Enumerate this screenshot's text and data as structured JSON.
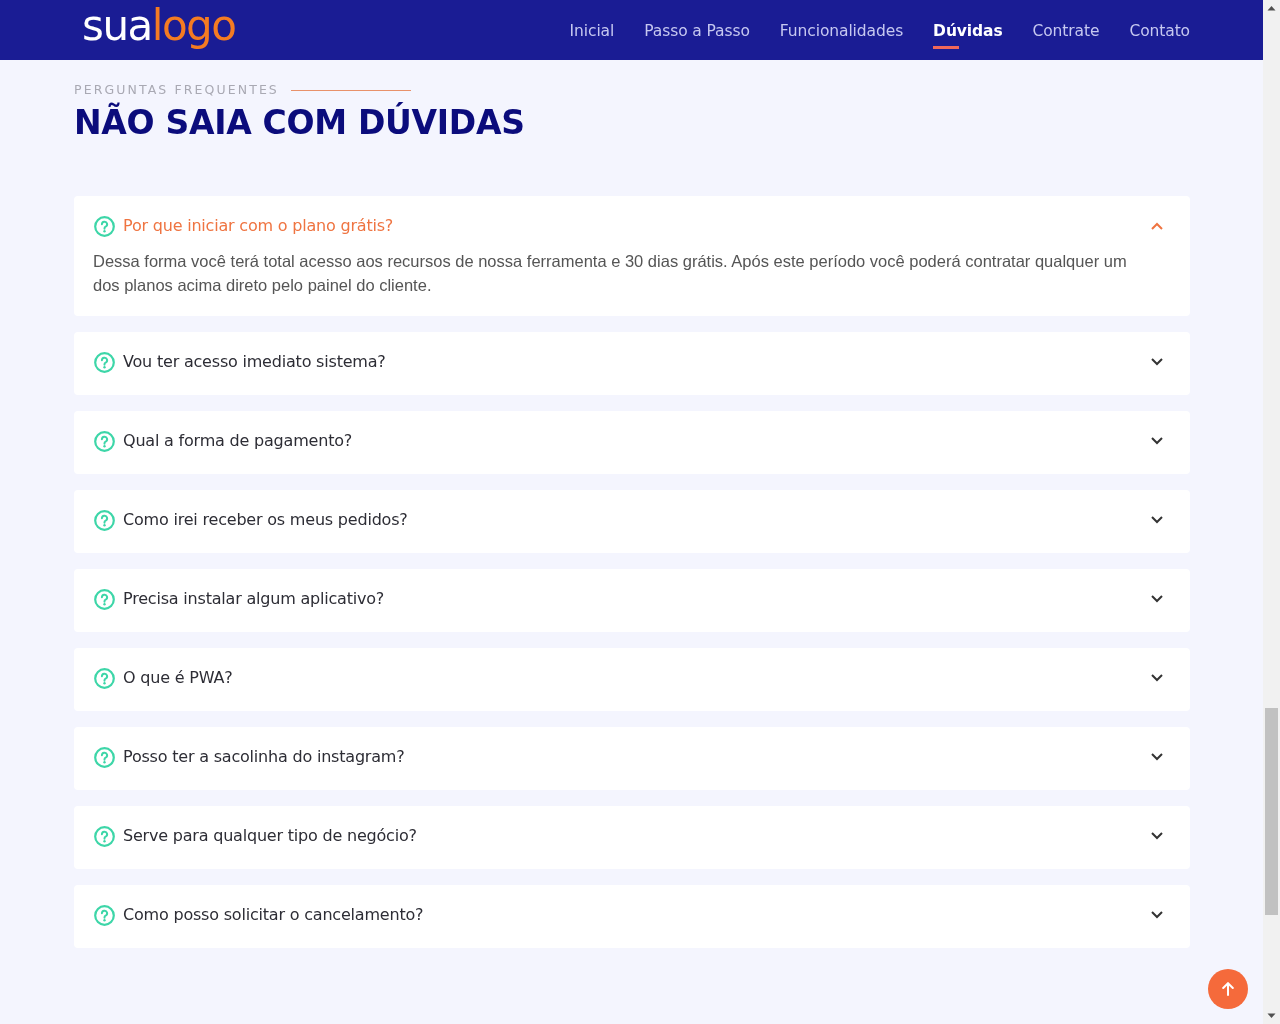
{
  "header": {
    "logo": {
      "text": "sua",
      "accent_text": "logo"
    },
    "nav": [
      {
        "label": "Inicial",
        "selected": false
      },
      {
        "label": "Passo a Passo",
        "selected": false
      },
      {
        "label": "Funcionalidades",
        "selected": false
      },
      {
        "label": "Dúvidas",
        "selected": true
      },
      {
        "label": "Contrate",
        "selected": false
      },
      {
        "label": "Contato",
        "selected": false
      }
    ]
  },
  "faq": {
    "eyebrow": "PERGUNTAS FREQUENTES",
    "title": "NÃO SAIA COM DÚVIDAS",
    "items": [
      {
        "question": "Por que iniciar com o plano grátis?",
        "expanded": true,
        "answer": "Dessa forma você terá total acesso aos recursos de nossa ferramenta e 30 dias grátis. Após este período você poderá contratar qualquer um dos planos acima direto pelo painel do cliente."
      },
      {
        "question": "Vou ter acesso imediato sistema?",
        "expanded": false
      },
      {
        "question": "Qual a forma de pagamento?",
        "expanded": false
      },
      {
        "question": "Como irei receber os meus pedidos?",
        "expanded": false
      },
      {
        "question": "Precisa instalar algum aplicativo?",
        "expanded": false
      },
      {
        "question": "O que é PWA?",
        "expanded": false
      },
      {
        "question": "Posso ter a sacolinha do instagram?",
        "expanded": false
      },
      {
        "question": "Serve para qualquer tipo de negócio?",
        "expanded": false
      },
      {
        "question": "Como posso solicitar o cancelamento?",
        "expanded": false
      }
    ]
  }
}
